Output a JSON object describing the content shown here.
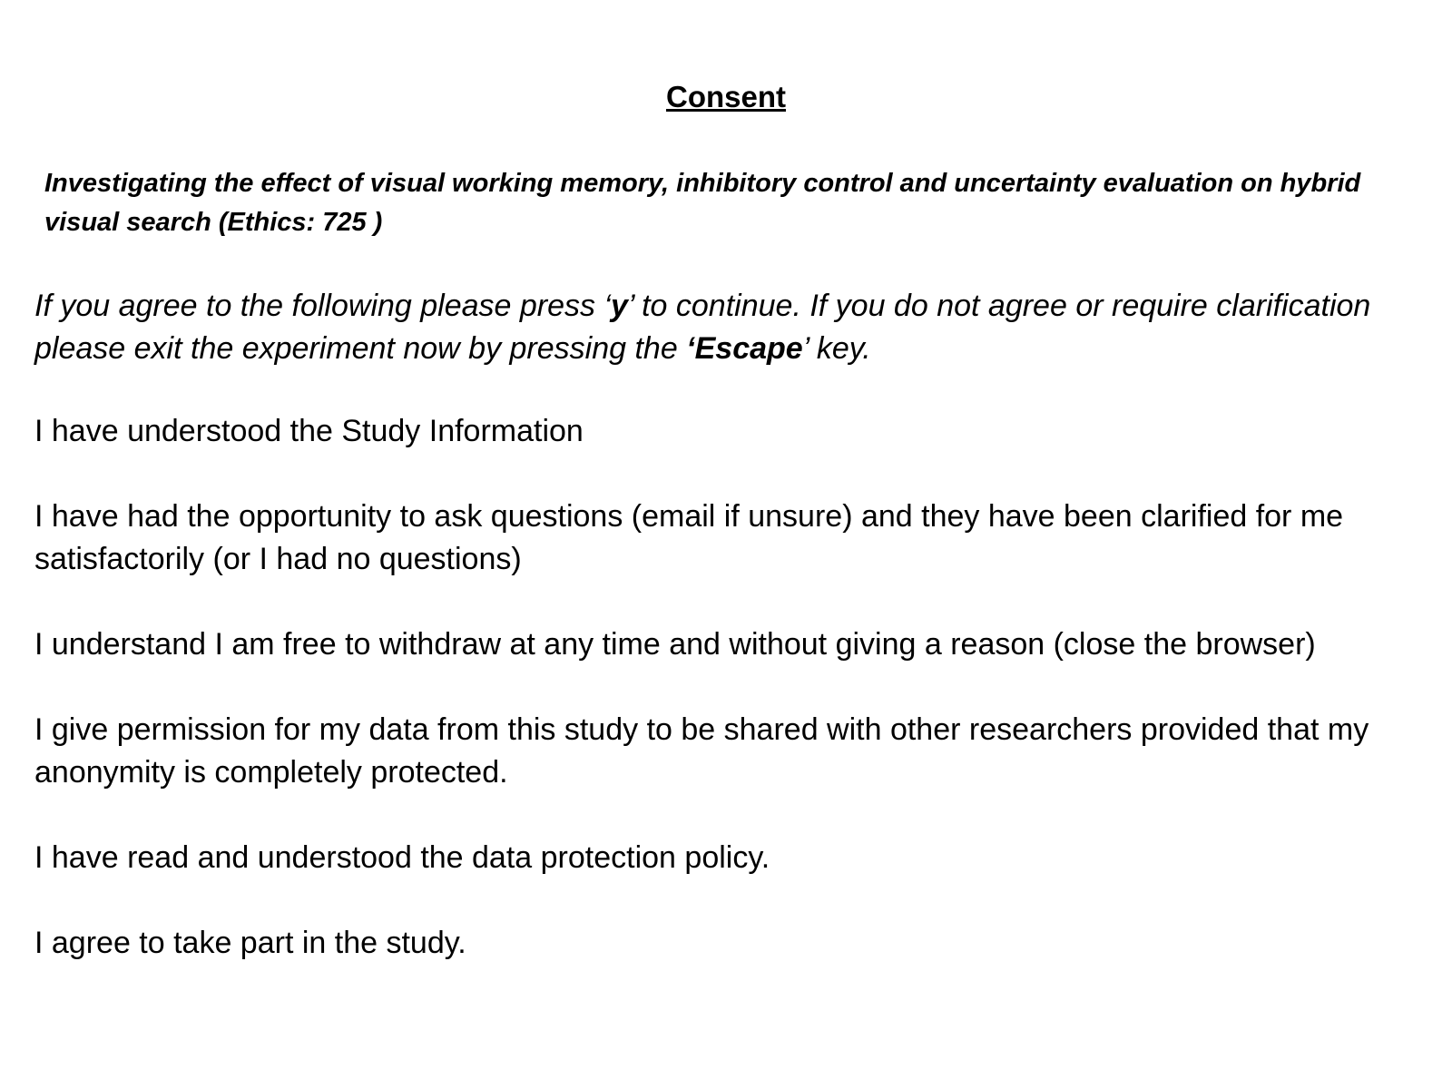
{
  "title": "Consent",
  "study_title": "Investigating the effect of visual working memory, inhibitory control and uncertainty evaluation on hybrid visual search (Ethics: 725 )",
  "instruction": {
    "part1": "If you agree to the following please press ‘",
    "key_continue": "y",
    "part2": "’ to continue. If you do not agree or require clarification please exit the experiment now by pressing the ",
    "key_exit": "‘Escape",
    "part3": "’ key."
  },
  "statements": [
    "I have understood the Study Information",
    "I have had the opportunity to ask questions (email if unsure) and they have been clarified for me satisfactorily (or I had no questions)",
    "I understand I am free to withdraw at any time and without giving a reason (close the browser)",
    "I give permission for my data from this study to be shared with other researchers provided that my anonymity is completely protected.",
    "I have read and understood the data protection policy.",
    "I agree to take part in the study."
  ]
}
